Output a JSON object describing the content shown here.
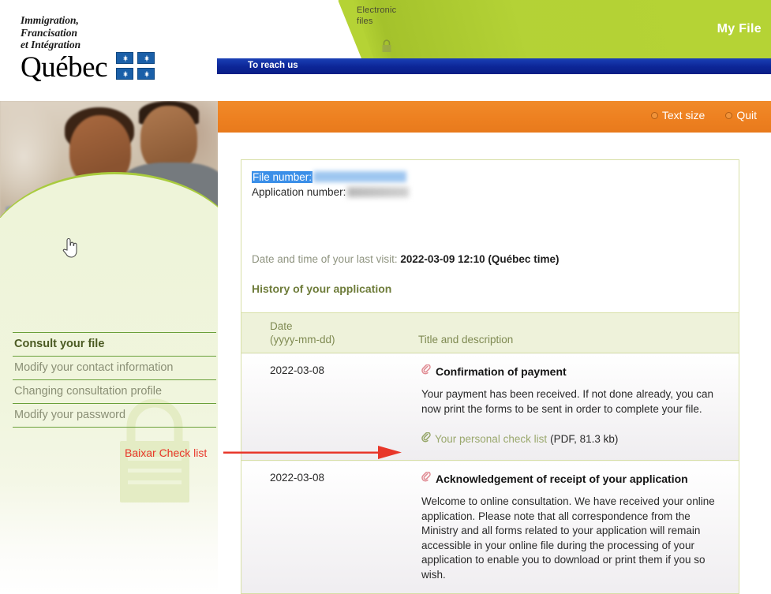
{
  "header": {
    "department_name": "Immigration,\nFrancisation\net Intégration",
    "dept_line1": "Immigration,",
    "dept_line2": "Francisation",
    "dept_line3": "et Intégration",
    "wordmark": "Québec",
    "electronic_files_line1": "Electronic",
    "electronic_files_line2": "files",
    "my_file": "My File",
    "reach_us": "To reach us",
    "lock_icon": "lock-icon",
    "green": "#b5d335",
    "blue": "#0c2596"
  },
  "toolbar": {
    "text_size": "Text size",
    "quit": "Quit",
    "orange": "#ee8121"
  },
  "sidebar": {
    "items": [
      {
        "label": "Consult your file",
        "active": true
      },
      {
        "label": "Modify your contact information",
        "active": false
      },
      {
        "label": "Changing consultation profile",
        "active": false
      },
      {
        "label": "Modify your password",
        "active": false
      }
    ],
    "watermark_icon": "lock-icon",
    "hero_image": "photo-of-two-people-at-laptop"
  },
  "main": {
    "file_number_label": "File number:",
    "file_number_value": "",
    "application_number_label": "Application number:",
    "application_number_value": "",
    "last_visit_label": "Date and time of your last visit:",
    "last_visit_value": "2022-03-09 12:10 (Québec time)",
    "history_title": "History of your application",
    "table": {
      "columns": [
        {
          "line1": "Date",
          "line2": "(yyyy-mm-dd)"
        },
        {
          "line1": "Title and description",
          "line2": ""
        }
      ],
      "rows": [
        {
          "date": "2022-03-08",
          "title": "Confirmation of payment",
          "title_icon": "paperclip-icon",
          "body": "Your payment has been received. If not done already, you can now print the forms to be sent in order to complete your file.",
          "attachment": {
            "icon": "paperclip-icon",
            "link_text": "Your personal check list",
            "meta": "(PDF, 81.3 kb)"
          }
        },
        {
          "date": "2022-03-08",
          "title": "Acknowledgement of receipt of your application",
          "title_icon": "paperclip-icon",
          "body": "Welcome to online consultation. We have received your online application. Please note that all correspondence from the Ministry and all forms related to your application will remain accessible in your online file during the processing of your application to enable you to download or print them if you so wish.",
          "attachment": null
        }
      ]
    }
  },
  "annotation": {
    "text": "Baixar Check list",
    "color": "#e8372a",
    "arrow_icon": "right-arrow-icon"
  },
  "cursor": {
    "icon": "hand-pointer-cursor"
  }
}
